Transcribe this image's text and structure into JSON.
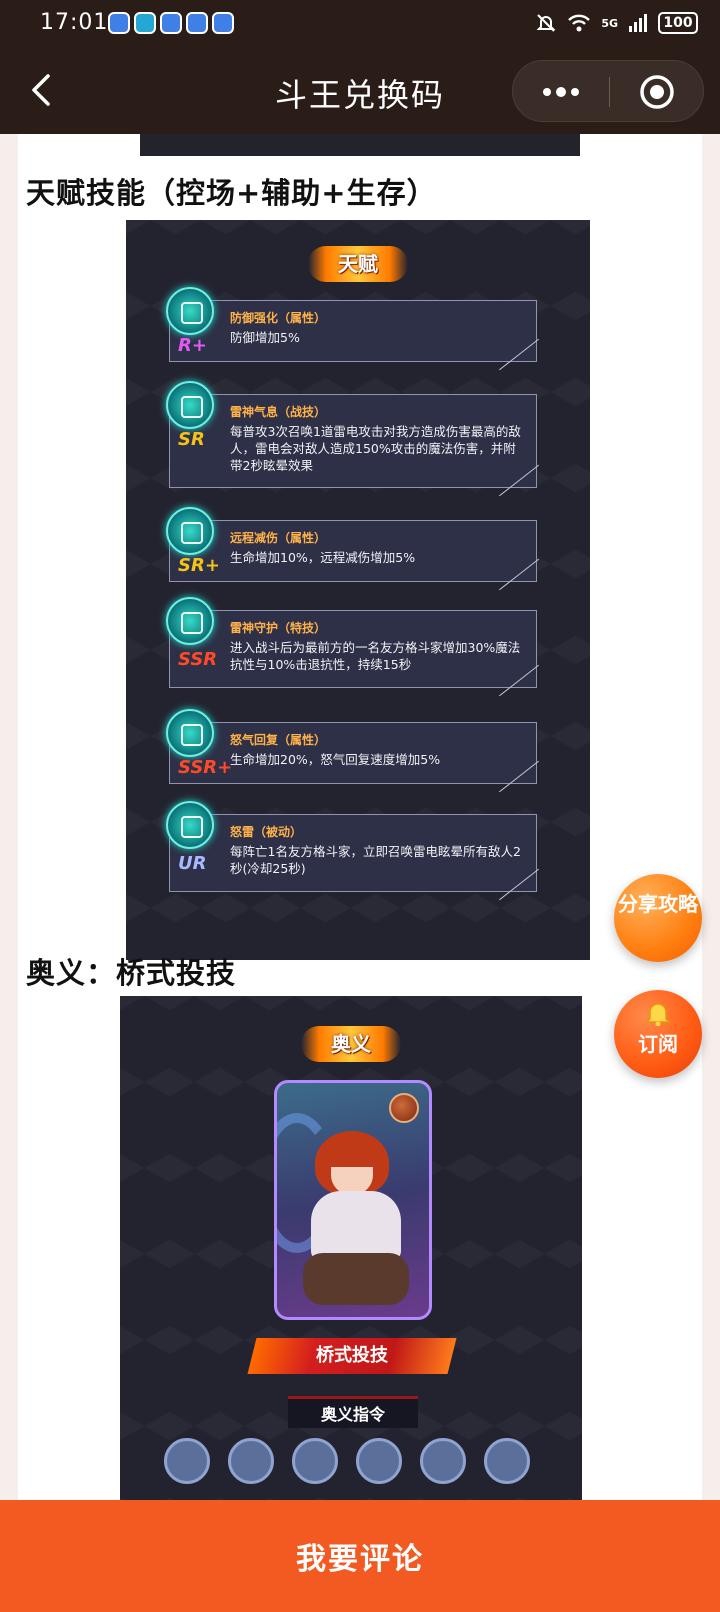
{
  "status_bar": {
    "time": "17:01",
    "network": "5G",
    "battery": "100",
    "icons": [
      "mute-bell-icon",
      "wifi-icon",
      "signal-icon",
      "battery-icon"
    ]
  },
  "header": {
    "title": "斗王兑换码",
    "back_icon": "chevron-left-icon",
    "more_icon": "more-dots-icon",
    "close_icon": "target-circle-icon"
  },
  "sections": {
    "talent_heading": "天赋技能（控场+辅助+生存）",
    "ougi_heading": "奥义：桥式投技"
  },
  "talent_panel": {
    "banner": "天赋",
    "items": [
      {
        "rarity": "R+",
        "rarity_color": "#e05cf0",
        "name": "防御强化（属性）",
        "desc": "防御增加5%"
      },
      {
        "rarity": "SR",
        "rarity_color": "#f4c21a",
        "name": "雷神气息（战技）",
        "desc": "每普攻3次召唤1道雷电攻击对我方造成伤害最高的敌人，雷电会对敌人造成150%攻击的魔法伤害，并附带2秒眩晕效果"
      },
      {
        "rarity": "SR+",
        "rarity_color": "#f4c21a",
        "name": "远程减伤（属性）",
        "desc": "生命增加10%，远程减伤增加5%"
      },
      {
        "rarity": "SSR",
        "rarity_color": "#ff4a2a",
        "name": "雷神守护（特技）",
        "desc": "进入战斗后为最前方的一名友方格斗家增加30%魔法抗性与10%击退抗性，持续15秒"
      },
      {
        "rarity": "SSR+",
        "rarity_color": "#ff4a2a",
        "name": "怒气回复（属性）",
        "desc": "生命增加20%，怒气回复速度增加5%"
      },
      {
        "rarity": "UR",
        "rarity_color": "#a9b9ff",
        "name": "怒雷（被动）",
        "desc": "每阵亡1名友方格斗家，立即召唤雷电眩晕所有敌人2秒(冷却25秒)"
      }
    ]
  },
  "ougi_panel": {
    "banner": "奥义",
    "skill_name": "桥式投技",
    "command_label": "奥义指令"
  },
  "floating": {
    "share_label": "分享攻略",
    "subscribe_label": "订阅",
    "subscribe_icon": "bell-icon"
  },
  "bottom": {
    "comment_label": "我要评论"
  }
}
